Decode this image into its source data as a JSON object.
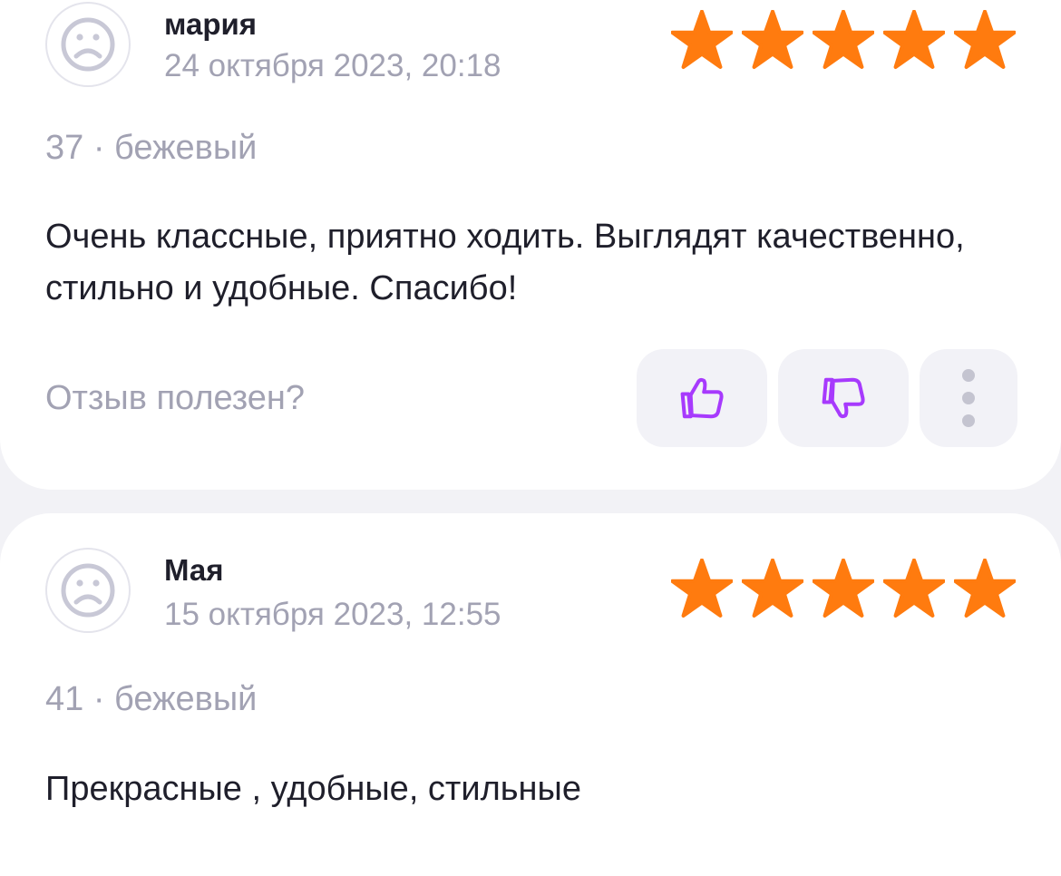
{
  "reviews": [
    {
      "author": "мария",
      "date": "24 октября 2023, 20:18",
      "rating": 5,
      "variant": "37 · бежевый",
      "text": "Очень классные, приятно ходить. Выглядят качественно, стильно и удобные. Спасибо!",
      "helpful_label": "Отзыв полезен?",
      "icons": {
        "avatar": "sad-face-avatar-icon",
        "like": "thumbs-up-icon",
        "dislike": "thumbs-down-icon",
        "more": "more-vertical-icon"
      }
    },
    {
      "author": "Мая",
      "date": "15 октября 2023, 12:55",
      "rating": 5,
      "variant": "41 · бежевый",
      "text": "Прекрасные , удобные, стильные",
      "icons": {
        "avatar": "sad-face-avatar-icon"
      }
    }
  ],
  "colors": {
    "star": "#ff7b0f",
    "accent": "#a73afd",
    "muted_text": "#a2a2b3",
    "primary_text": "#1f1f2b",
    "page_background": "#f2f2f6",
    "card_background": "#ffffff",
    "button_background": "#f2f2f7"
  }
}
